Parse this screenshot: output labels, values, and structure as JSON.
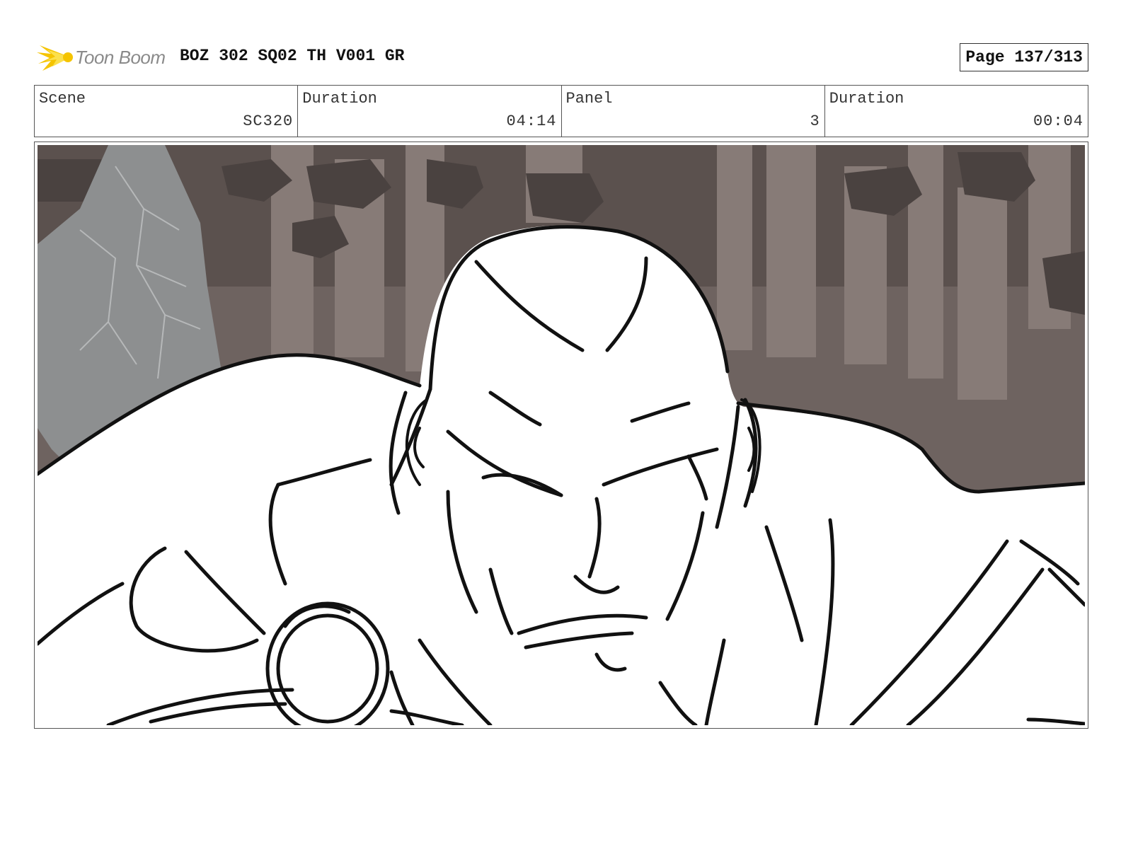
{
  "header": {
    "logo_text": "Toon Boom",
    "doc_title": "BOZ 302 SQ02 TH V001 GR",
    "page_label": "Page 137/313"
  },
  "info": {
    "scene_label": "Scene",
    "scene_value": "SC320",
    "scene_duration_label": "Duration",
    "scene_duration_value": "04:14",
    "panel_label": "Panel",
    "panel_value": "3",
    "panel_duration_label": "Duration",
    "panel_duration_value": "00:04"
  },
  "colors": {
    "logo_yellow": "#f5c400",
    "logo_gray": "#8a8a8a",
    "rock_dark": "#4a4240",
    "rock_mid": "#6e6360",
    "rock_light": "#877b77",
    "stone_gray": "#8d8f90"
  }
}
